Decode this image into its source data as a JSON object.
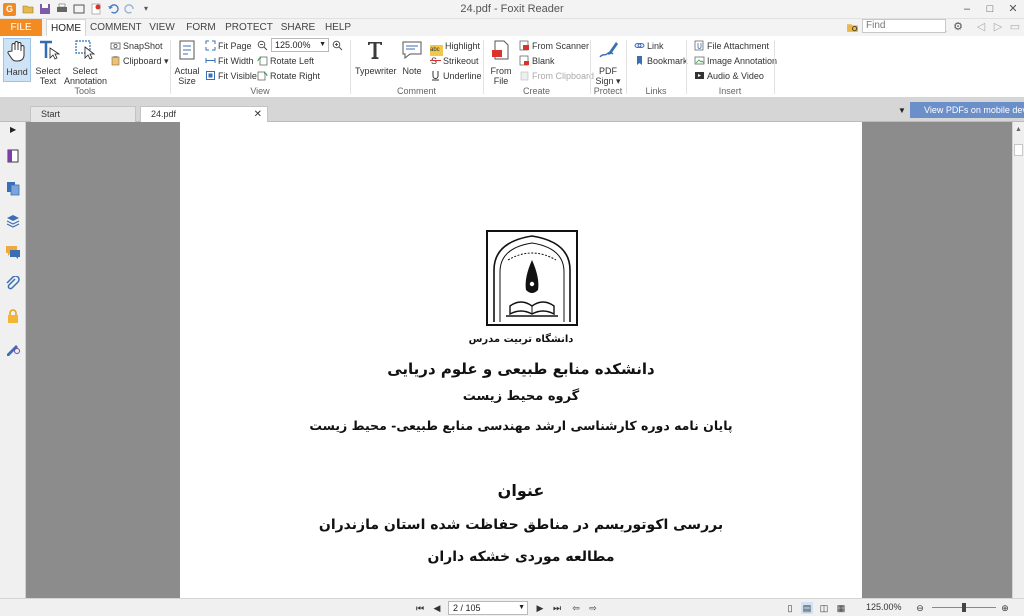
{
  "window": {
    "title": "24.pdf - Foxit Reader",
    "logo_letter": "G"
  },
  "ribbon_tabs": {
    "file": "FILE",
    "home": "HOME",
    "comment": "COMMENT",
    "view": "VIEW",
    "form": "FORM",
    "protect": "PROTECT",
    "share": "SHARE",
    "help": "HELP"
  },
  "search": {
    "placeholder": "Find"
  },
  "tools_group": {
    "label": "Tools",
    "hand": "Hand",
    "select_text_1": "Select",
    "select_text_2": "Text",
    "select_annotation_1": "Select",
    "select_annotation_2": "Annotation",
    "snapshot": "SnapShot",
    "clipboard": "Clipboard"
  },
  "view_group": {
    "label": "View",
    "actual_size_1": "Actual",
    "actual_size_2": "Size",
    "fit_page": "Fit Page",
    "fit_width": "Fit Width",
    "fit_visible": "Fit Visible",
    "zoom_value": "125.00%",
    "rotate_left": "Rotate Left",
    "rotate_right": "Rotate Right"
  },
  "comment_group": {
    "label": "Comment",
    "typewriter": "Typewriter",
    "note": "Note",
    "highlight": "Highlight",
    "strikeout": "Strikeout",
    "underline": "Underline"
  },
  "create_group": {
    "label": "Create",
    "from_file_1": "From",
    "from_file_2": "File",
    "from_scanner": "From Scanner",
    "blank": "Blank",
    "from_clipboard": "From Clipboard"
  },
  "protect_group": {
    "label": "Protect",
    "pdf_sign_1": "PDF",
    "pdf_sign_2": "Sign"
  },
  "links_group": {
    "label": "Links",
    "link": "Link",
    "bookmark": "Bookmark"
  },
  "insert_group": {
    "label": "Insert",
    "file_attachment": "File Attachment",
    "image_annotation": "Image Annotation",
    "audio_video": "Audio & Video"
  },
  "doc_tabs": {
    "start": "Start",
    "current": "24.pdf",
    "mobile_banner": "View PDFs on mobile devices"
  },
  "document": {
    "university": "دانشگاه تربیت مدرس",
    "faculty": "دانشکده منابع طبیعی و علوم دریایی",
    "department": "گروه  محیط زیست",
    "thesis": "پایان نامه دوره کارشناسی ارشد مهندسی منابع طبیعی- محیط زیست",
    "title_label": "عنوان",
    "title_line1": "بررسی اکوتوریسم در مناطق حفاظت شده استان مازندران",
    "title_line2": "مطالعه موردی خشکه داران"
  },
  "status": {
    "page": "2 / 105",
    "zoom": "125.00%"
  },
  "colors": {
    "file_tab": "#f28c22",
    "banner": "#6b8fc9",
    "doc_bg": "#8c8c8c"
  }
}
